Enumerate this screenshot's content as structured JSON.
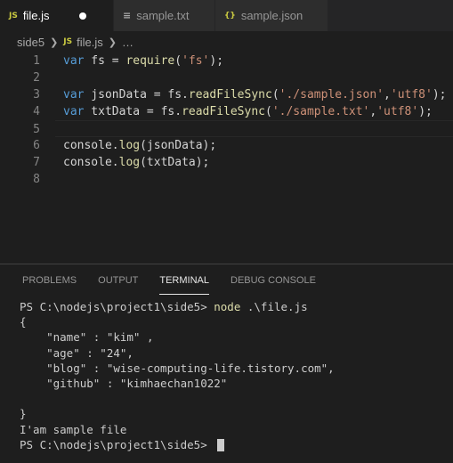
{
  "tabs": [
    {
      "icon": "JS",
      "label": "file.js",
      "modified": true
    },
    {
      "icon": "≡",
      "label": "sample.txt"
    },
    {
      "icon": "{}",
      "label": "sample.json"
    }
  ],
  "breadcrumb": {
    "folder": "side5",
    "file_icon": "JS",
    "file": "file.js",
    "more": "…"
  },
  "editor": {
    "line_numbers": [
      "1",
      "2",
      "3",
      "4",
      "5",
      "6",
      "7",
      "8"
    ],
    "lines": [
      [
        "var",
        " fs = ",
        "require",
        "(",
        "'fs'",
        ");"
      ],
      [],
      [
        "var",
        " jsonData = fs.",
        "readFileSync",
        "(",
        "'./sample.json'",
        ",",
        "'utf8'",
        ");"
      ],
      [
        "var",
        " txtData = fs.",
        "readFileSync",
        "(",
        "'./sample.txt'",
        ",",
        "'utf8'",
        ");"
      ],
      [],
      [
        "console.",
        "log",
        "(jsonData);"
      ],
      [
        "console.",
        "log",
        "(txtData);"
      ],
      []
    ]
  },
  "panel": {
    "tabs": [
      "PROBLEMS",
      "OUTPUT",
      "TERMINAL",
      "DEBUG CONSOLE"
    ],
    "active_tab": "TERMINAL",
    "terminal": {
      "prompt": "PS C:\\nodejs\\project1\\side5> ",
      "command": "node",
      "command_args": " .\\file.js",
      "output": [
        "{",
        "    \"name\" : \"kim\" ,",
        "    \"age\" : \"24\",",
        "    \"blog\" : \"wise-computing-life.tistory.com\",",
        "    \"github\" : \"kimhaechan1022\"",
        "",
        "}",
        "I'am sample file"
      ],
      "final_prompt": "PS C:\\nodejs\\project1\\side5> "
    }
  }
}
